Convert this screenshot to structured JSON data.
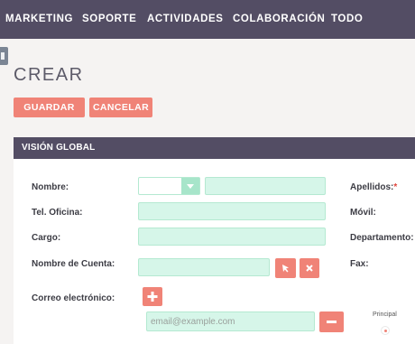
{
  "nav": {
    "items": [
      "MARKETING",
      "SOPORTE",
      "ACTIVIDADES",
      "COLABORACIÓN",
      "TODO"
    ]
  },
  "page": {
    "title": "CREAR",
    "save_label": "GUARDAR",
    "cancel_label": "CANCELAR"
  },
  "panel": {
    "title": "VISIÓN GLOBAL"
  },
  "form": {
    "nombre_label": "Nombre:",
    "apellidos_label": "Apellidos:",
    "apellidos_required": "*",
    "tel_oficina_label": "Tel. Oficina:",
    "movil_label": "Móvil:",
    "cargo_label": "Cargo:",
    "departamento_label": "Departamento:",
    "nombre_cuenta_label": "Nombre de Cuenta:",
    "fax_label": "Fax:",
    "correo_label": "Correo electrónico:",
    "email_placeholder": "email@example.com",
    "principal_label": "Principal",
    "nombre_value": "",
    "salutation_value": ""
  },
  "colors": {
    "nav_bg": "#534d64",
    "accent": "#f08377",
    "field_bg": "#d6f6e9"
  },
  "icons": {
    "select_arrow": "chevron-down-icon",
    "select_account": "cursor-arrow-icon",
    "clear_account": "close-icon",
    "add_email": "plus-icon",
    "remove_email": "minus-icon"
  }
}
